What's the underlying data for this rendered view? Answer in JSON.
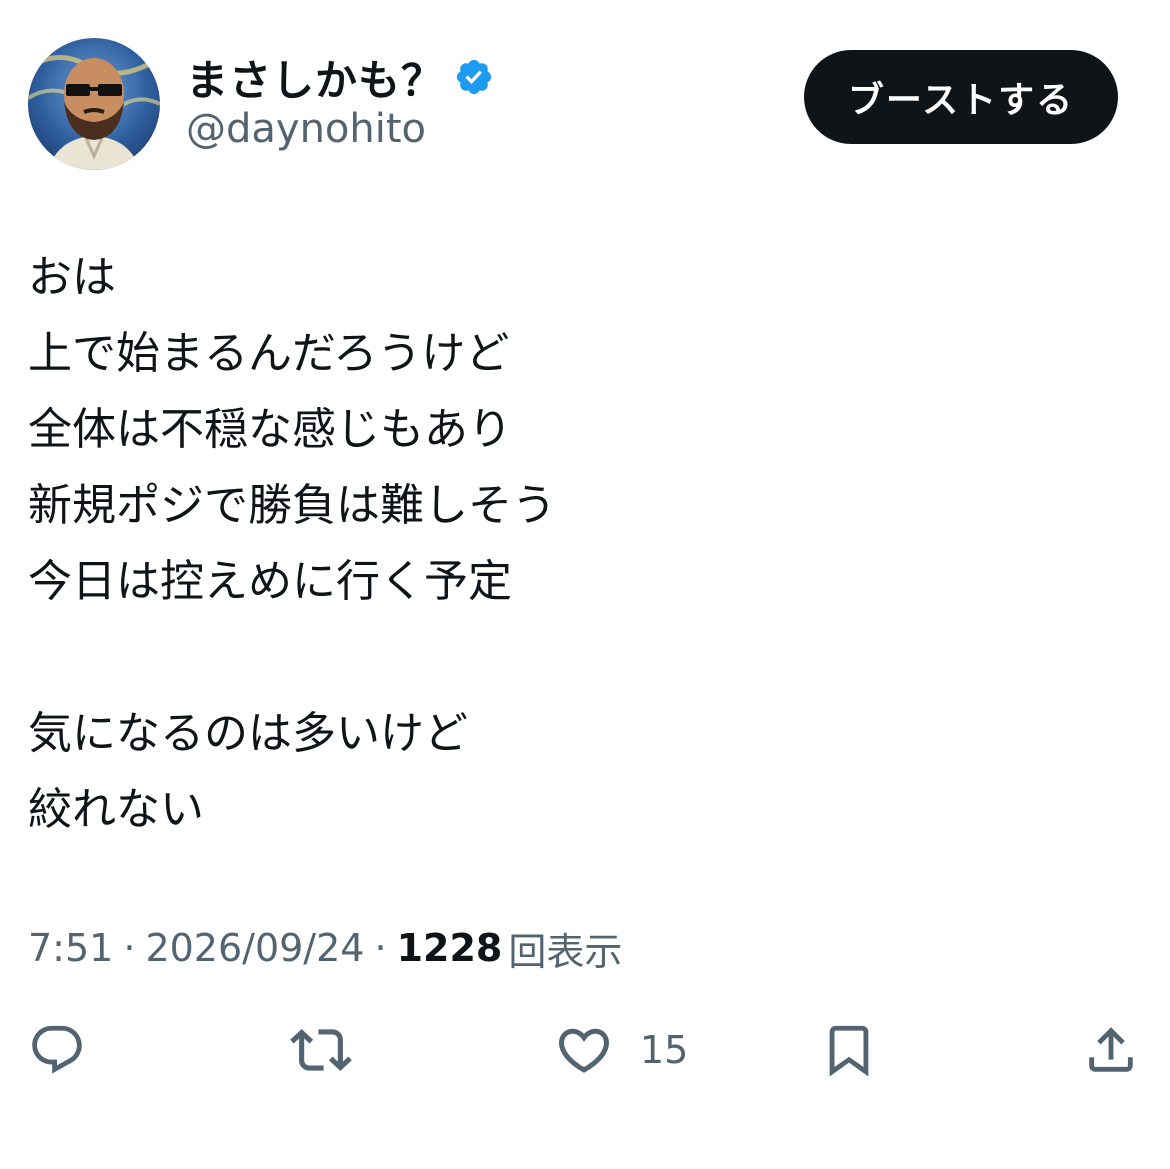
{
  "author": {
    "display_name": "まさしかも？",
    "handle": "@daynohito",
    "verified_icon": "verified-badge-icon",
    "badge_color": "#1d9bf0"
  },
  "boost_button": {
    "label": "ブーストする"
  },
  "tweet": {
    "lines": [
      "おは",
      "上で始まるんだろうけど",
      "全体は不穏な感じもあり",
      "新規ポジで勝負は難しそう",
      "今日は控えめに行く予定",
      "",
      "気になるのは多いけど",
      "絞れない"
    ]
  },
  "meta": {
    "time": "7:51",
    "date": "2026/09/24",
    "separator": "·",
    "views": "1228",
    "views_label": "回表示"
  },
  "actions": {
    "reply_icon": "reply-icon",
    "retweet_icon": "retweet-icon",
    "like_icon": "heart-icon",
    "like_count": "15",
    "bookmark_icon": "bookmark-icon",
    "share_icon": "share-icon",
    "icon_color": "#536471"
  }
}
